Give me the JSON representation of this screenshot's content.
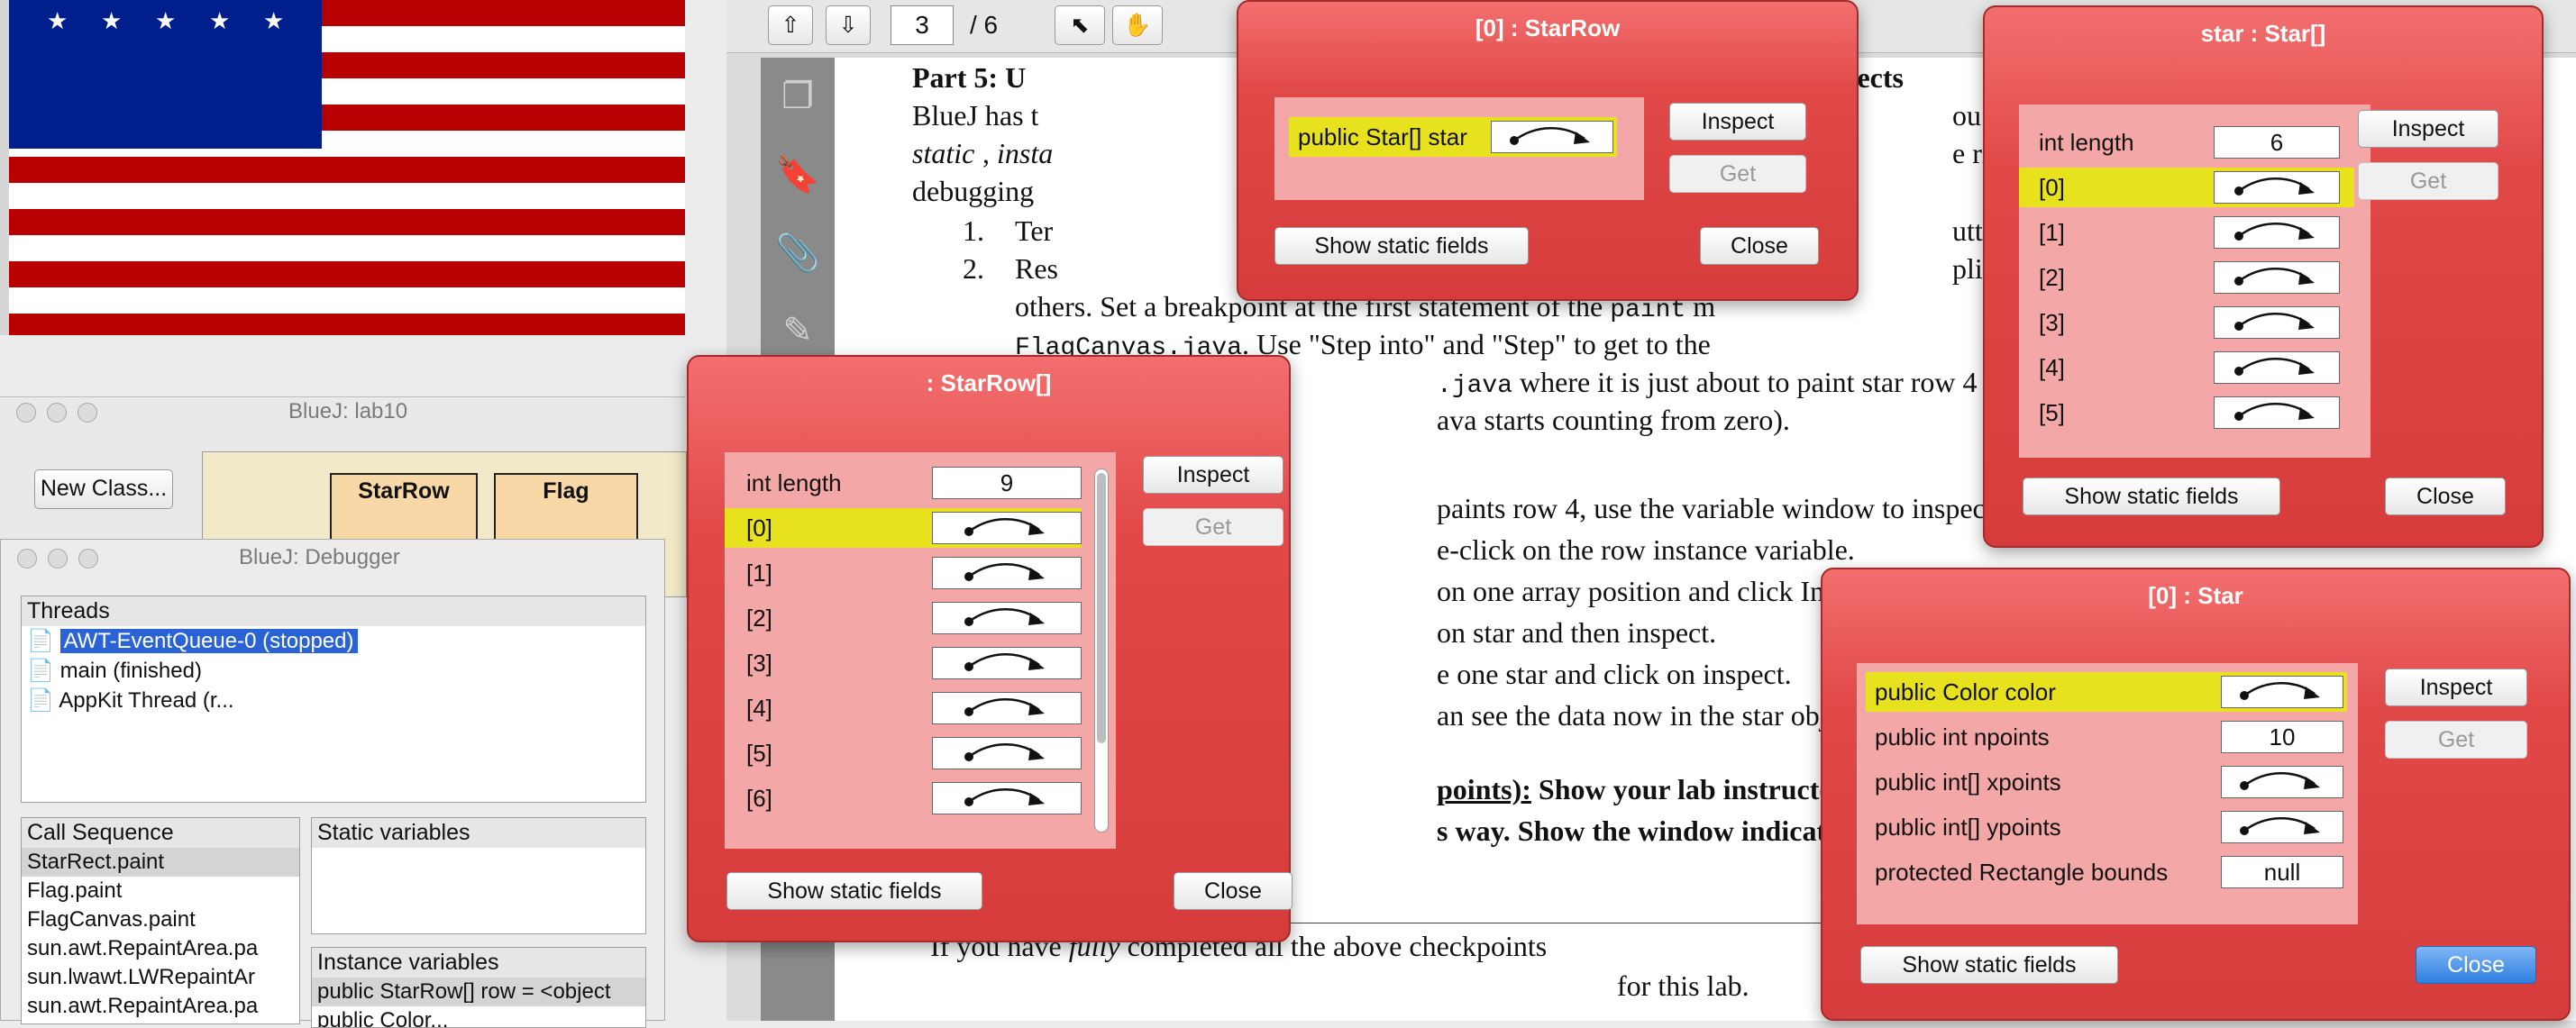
{
  "flag": {
    "canton_color": "#001e8c",
    "stripe_red": "#b90000",
    "stripe_white": "#ffffff"
  },
  "bluej": {
    "title": "BlueJ:  lab10",
    "new_class_label": "New Class...",
    "classes": [
      "StarRow",
      "Flag"
    ]
  },
  "debugger": {
    "title": "BlueJ:  Debugger",
    "threads_header": "Threads",
    "threads": [
      "AWT-EventQueue-0 (stopped)",
      "main (finished)",
      "AppKit Thread (r..."
    ],
    "call_sequence_header": "Call Sequence",
    "call_sequence": [
      "StarRect.paint",
      "Flag.paint",
      "FlagCanvas.paint",
      "sun.awt.RepaintArea.pa",
      "sun.lwawt.LWRepaintAr",
      "sun.awt.RepaintArea.pa"
    ],
    "static_header": "Static variables",
    "instance_header": "Instance variables",
    "instance_vars": [
      "public StarRow[] row = <object",
      "public Color..."
    ]
  },
  "pdf": {
    "page_number": "3",
    "page_total": "/ 6",
    "lines": {
      "heading": "Part 5: U",
      "heading_tail": "y objects",
      "l1a": "BlueJ has t",
      "l1b": "ou are deb",
      "l2a_italic": "static",
      "l2b": ", ",
      "l2c_italic": "insta",
      "l2d": "e right han",
      "l3": "debugging",
      "item1_num": "1.",
      "item1a": "Ter",
      "item1b": "utton on th",
      "item2_num": "2.",
      "item2a": "Res",
      "item2b": "plication w",
      "l4a": "others. Set a breakpoint at the first statement of the ",
      "l4mono": "paint",
      "l4c": " m",
      "l5mono": "FlagCanvas.java",
      "l5b": ". Use \"Step into\" and \"Step\" to get to the",
      "l6mono": ".java",
      "l6b": " where it is just about to paint star row 4 (t",
      "l7": "ava starts counting from zero).",
      "l8": "paints row 4, use the variable window to inspect r",
      "l9": "e-click on the row instance variable.",
      "l10": "on one array position and click Inspe",
      "l11": "on star and then inspect.",
      "l12": "e one star and click on inspect.",
      "l13": "an see the data now in the star object",
      "l14a": "points):",
      "l14b": " Show your lab instructor",
      "l15": "s way. Show the window indicating",
      "l16a": "If you have ",
      "l16b_italic": "fully",
      "l16c": " completed all the above checkpoints",
      "l17": "for this lab."
    }
  },
  "inspector_starrow": {
    "title": "[0] : StarRow",
    "field_label": "public Star[] star",
    "inspect_label": "Inspect",
    "get_label": "Get",
    "static_label": "Show static fields",
    "close_label": "Close"
  },
  "inspector_starrow_array": {
    "title": ": StarRow[]",
    "length_label": "int length",
    "length_value": "9",
    "items": [
      "[0]",
      "[1]",
      "[2]",
      "[3]",
      "[4]",
      "[5]",
      "[6]"
    ],
    "inspect_label": "Inspect",
    "get_label": "Get",
    "static_label": "Show static fields",
    "close_label": "Close"
  },
  "inspector_star_array": {
    "title": "star : Star[]",
    "length_label": "int length",
    "length_value": "6",
    "items": [
      "[0]",
      "[1]",
      "[2]",
      "[3]",
      "[4]",
      "[5]"
    ],
    "inspect_label": "Inspect",
    "get_label": "Get",
    "static_label": "Show static fields",
    "close_label": "Close"
  },
  "inspector_star": {
    "title": "[0] : Star",
    "fields": [
      {
        "label": "public Color color",
        "value": ""
      },
      {
        "label": "public int npoints",
        "value": "10"
      },
      {
        "label": "public int[] xpoints",
        "value": ""
      },
      {
        "label": "public int[] ypoints",
        "value": ""
      },
      {
        "label": "protected Rectangle bounds",
        "value": "null"
      }
    ],
    "inspect_label": "Inspect",
    "get_label": "Get",
    "static_label": "Show static fields",
    "close_label": "Close"
  }
}
